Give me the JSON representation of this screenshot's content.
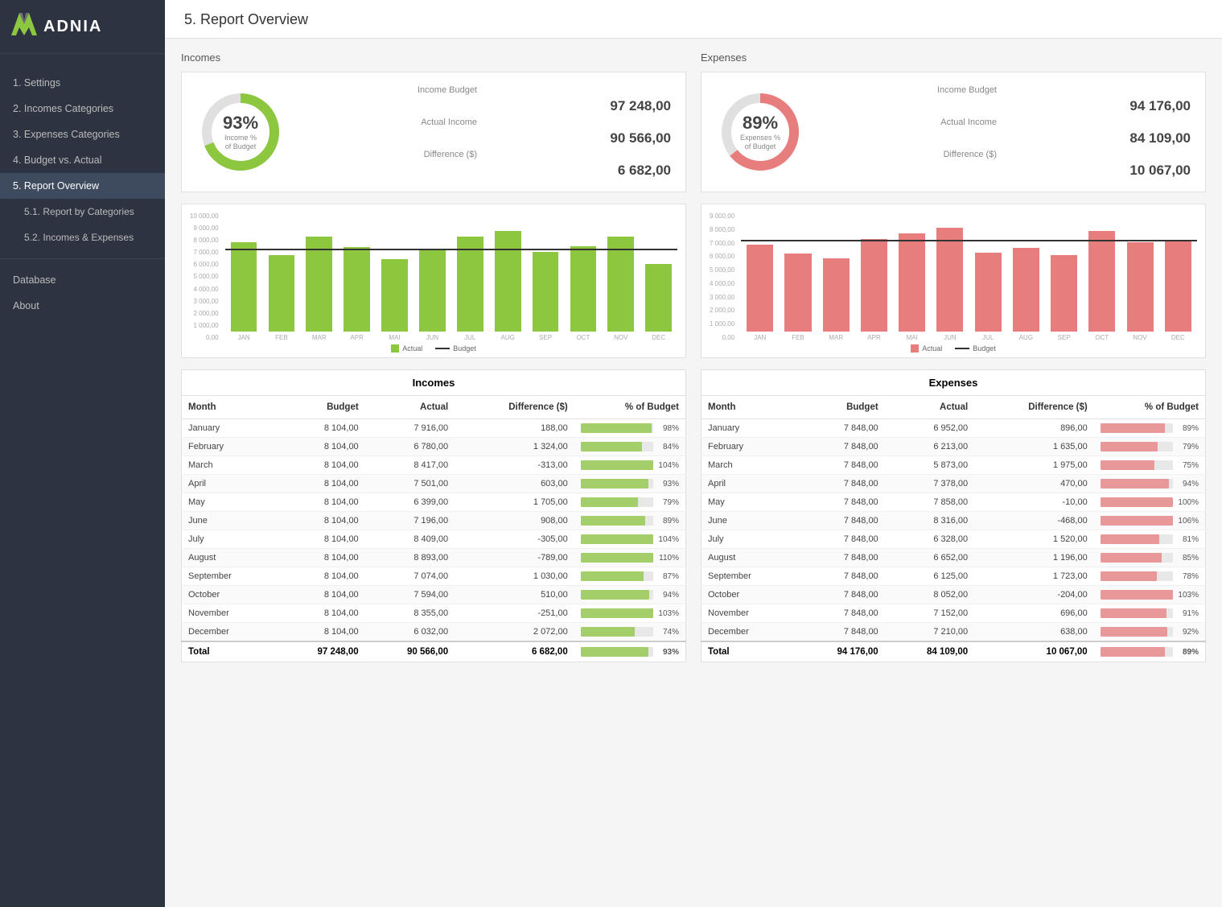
{
  "sidebar": {
    "logo_icon": "✕✕",
    "logo_text": "ADNIA",
    "items": [
      {
        "id": "settings",
        "label": "1. Settings",
        "active": false,
        "sub": false
      },
      {
        "id": "incomes-cat",
        "label": "2. Incomes Categories",
        "active": false,
        "sub": false
      },
      {
        "id": "expenses-cat",
        "label": "3. Expenses Categories",
        "active": false,
        "sub": false
      },
      {
        "id": "budget-actual",
        "label": "4. Budget vs. Actual",
        "active": false,
        "sub": false
      },
      {
        "id": "report-overview",
        "label": "5. Report Overview",
        "active": true,
        "sub": false
      },
      {
        "id": "report-by-cat",
        "label": "5.1. Report by Categories",
        "active": false,
        "sub": true
      },
      {
        "id": "incomes-expenses",
        "label": "5.2. Incomes & Expenses",
        "active": false,
        "sub": true
      },
      {
        "id": "database",
        "label": "Database",
        "active": false,
        "sub": false
      },
      {
        "id": "about",
        "label": "About",
        "active": false,
        "sub": false
      }
    ]
  },
  "page": {
    "title": "5. Report Overview"
  },
  "incomes": {
    "section_title": "Incomes",
    "donut_pct": "93%",
    "donut_label1": "Income %",
    "donut_label2": "of Budget",
    "donut_fill_color": "#8dc63f",
    "donut_bg_color": "#e0e0e0",
    "stats": {
      "budget_label": "Income Budget",
      "budget_value": "97 248,00",
      "actual_label": "Actual Income",
      "actual_value": "90 566,00",
      "diff_label": "Difference ($)",
      "diff_value": "6 682,00"
    },
    "chart_title": "Incomes",
    "bar_color": "#8dc63f",
    "budget_line_pct": 72,
    "y_labels": [
      "10 000,00",
      "9 000,00",
      "8 000,00",
      "7 000,00",
      "6 000,00",
      "5 000,00",
      "4 000,00",
      "3 000,00",
      "2 000,00",
      "1 000,00",
      "0,00"
    ],
    "x_labels": [
      "JAN",
      "FEB",
      "MAR",
      "APR",
      "MAI",
      "JUN",
      "JUL",
      "AUG",
      "SEP",
      "OCT",
      "NOV",
      "DEC"
    ],
    "bar_heights_pct": [
      79,
      68,
      84,
      75,
      64,
      72,
      84,
      89,
      71,
      76,
      84,
      60
    ],
    "legend_actual": "Actual",
    "legend_budget": "Budget",
    "table": {
      "title": "Incomes",
      "headers": [
        "Month",
        "Budget",
        "Actual",
        "Difference ($)",
        "% of Budget"
      ],
      "rows": [
        {
          "month": "January",
          "budget": "8 104,00",
          "actual": "7 916,00",
          "diff": "188,00",
          "pct": 98
        },
        {
          "month": "February",
          "budget": "8 104,00",
          "actual": "6 780,00",
          "diff": "1 324,00",
          "pct": 84
        },
        {
          "month": "March",
          "budget": "8 104,00",
          "actual": "8 417,00",
          "diff": "-313,00",
          "pct": 104
        },
        {
          "month": "April",
          "budget": "8 104,00",
          "actual": "7 501,00",
          "diff": "603,00",
          "pct": 93
        },
        {
          "month": "May",
          "budget": "8 104,00",
          "actual": "6 399,00",
          "diff": "1 705,00",
          "pct": 79
        },
        {
          "month": "June",
          "budget": "8 104,00",
          "actual": "7 196,00",
          "diff": "908,00",
          "pct": 89
        },
        {
          "month": "July",
          "budget": "8 104,00",
          "actual": "8 409,00",
          "diff": "-305,00",
          "pct": 104
        },
        {
          "month": "August",
          "budget": "8 104,00",
          "actual": "8 893,00",
          "diff": "-789,00",
          "pct": 110
        },
        {
          "month": "September",
          "budget": "8 104,00",
          "actual": "7 074,00",
          "diff": "1 030,00",
          "pct": 87
        },
        {
          "month": "October",
          "budget": "8 104,00",
          "actual": "7 594,00",
          "diff": "510,00",
          "pct": 94
        },
        {
          "month": "November",
          "budget": "8 104,00",
          "actual": "8 355,00",
          "diff": "-251,00",
          "pct": 103
        },
        {
          "month": "December",
          "budget": "8 104,00",
          "actual": "6 032,00",
          "diff": "2 072,00",
          "pct": 74
        }
      ],
      "total": {
        "month": "Total",
        "budget": "97 248,00",
        "actual": "90 566,00",
        "diff": "6 682,00",
        "pct": 93
      }
    }
  },
  "expenses": {
    "section_title": "Expenses",
    "donut_pct": "89%",
    "donut_label1": "Expenses %",
    "donut_label2": "of Budget",
    "donut_fill_color": "#e87d7d",
    "donut_bg_color": "#e0e0e0",
    "stats": {
      "budget_label": "Income Budget",
      "budget_value": "94 176,00",
      "actual_label": "Actual Income",
      "actual_value": "84 109,00",
      "diff_label": "Difference ($)",
      "diff_value": "10 067,00"
    },
    "bar_color": "#e87d7d",
    "budget_line_pct": 80,
    "y_labels": [
      "9 000,00",
      "8 000,00",
      "7 000,00",
      "6 000,00",
      "5 000,00",
      "4 000,00",
      "3 000,00",
      "2 000,00",
      "1 000,00",
      "0,00"
    ],
    "x_labels": [
      "JAN",
      "FEB",
      "MAR",
      "APR",
      "MAI",
      "JUN",
      "JUL",
      "AUG",
      "SEP",
      "OCT",
      "NOV",
      "DEC"
    ],
    "bar_heights_pct": [
      77,
      69,
      65,
      82,
      87,
      92,
      70,
      74,
      68,
      89,
      79,
      80
    ],
    "legend_actual": "Actual",
    "legend_budget": "Budget",
    "table": {
      "title": "Expenses",
      "headers": [
        "Month",
        "Budget",
        "Actual",
        "Difference ($)",
        "% of Budget"
      ],
      "rows": [
        {
          "month": "January",
          "budget": "7 848,00",
          "actual": "6 952,00",
          "diff": "896,00",
          "pct": 89
        },
        {
          "month": "February",
          "budget": "7 848,00",
          "actual": "6 213,00",
          "diff": "1 635,00",
          "pct": 79
        },
        {
          "month": "March",
          "budget": "7 848,00",
          "actual": "5 873,00",
          "diff": "1 975,00",
          "pct": 75
        },
        {
          "month": "April",
          "budget": "7 848,00",
          "actual": "7 378,00",
          "diff": "470,00",
          "pct": 94
        },
        {
          "month": "May",
          "budget": "7 848,00",
          "actual": "7 858,00",
          "diff": "-10,00",
          "pct": 100
        },
        {
          "month": "June",
          "budget": "7 848,00",
          "actual": "8 316,00",
          "diff": "-468,00",
          "pct": 106
        },
        {
          "month": "July",
          "budget": "7 848,00",
          "actual": "6 328,00",
          "diff": "1 520,00",
          "pct": 81
        },
        {
          "month": "August",
          "budget": "7 848,00",
          "actual": "6 652,00",
          "diff": "1 196,00",
          "pct": 85
        },
        {
          "month": "September",
          "budget": "7 848,00",
          "actual": "6 125,00",
          "diff": "1 723,00",
          "pct": 78
        },
        {
          "month": "October",
          "budget": "7 848,00",
          "actual": "8 052,00",
          "diff": "-204,00",
          "pct": 103
        },
        {
          "month": "November",
          "budget": "7 848,00",
          "actual": "7 152,00",
          "diff": "696,00",
          "pct": 91
        },
        {
          "month": "December",
          "budget": "7 848,00",
          "actual": "7 210,00",
          "diff": "638,00",
          "pct": 92
        }
      ],
      "total": {
        "month": "Total",
        "budget": "94 176,00",
        "actual": "84 109,00",
        "diff": "10 067,00",
        "pct": 89
      }
    }
  }
}
